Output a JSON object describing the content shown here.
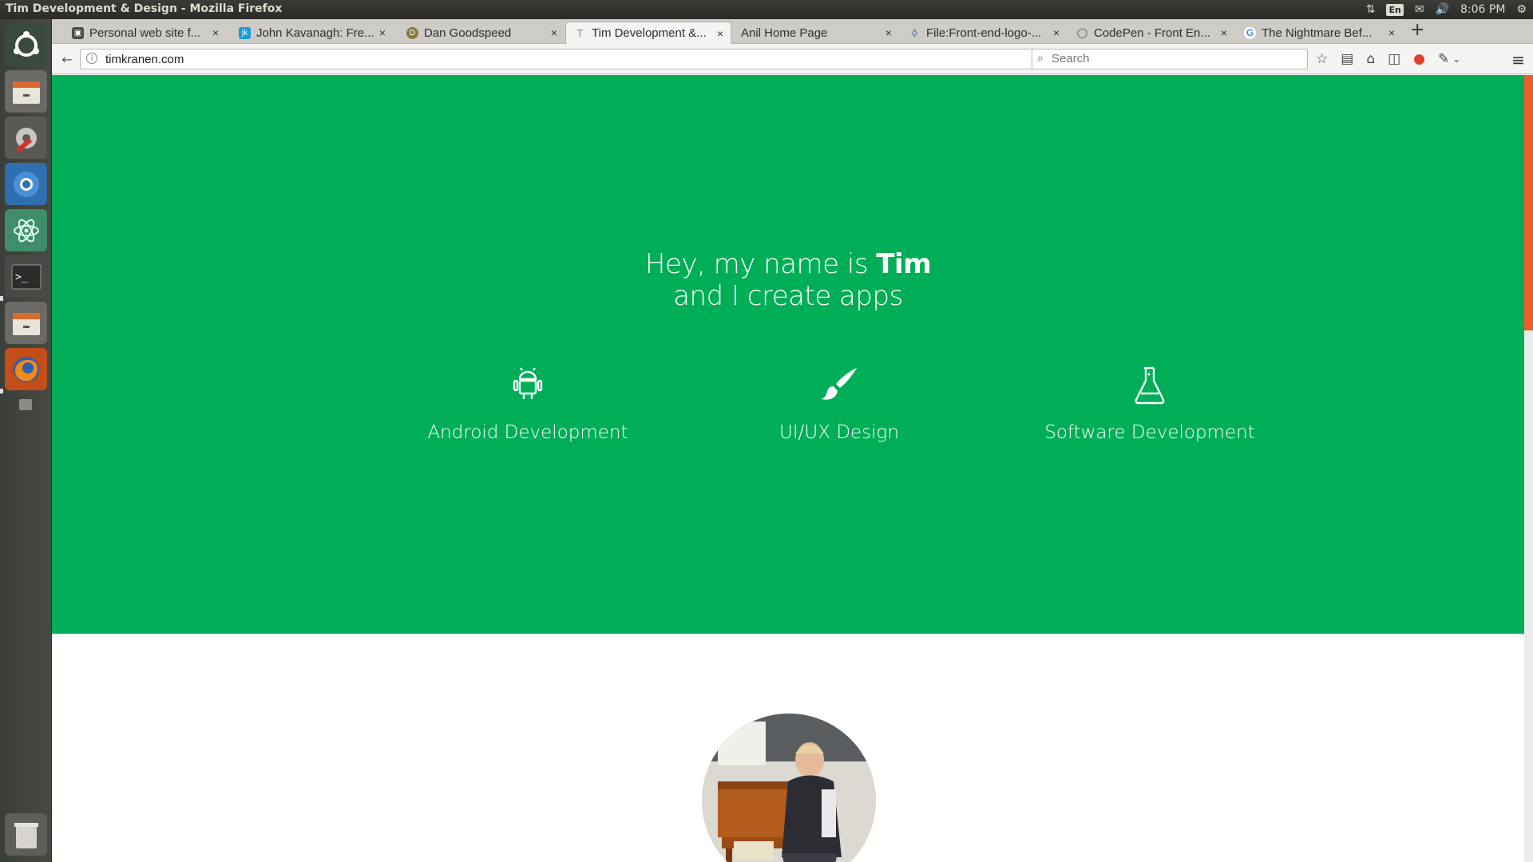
{
  "system": {
    "window_title": "Tim Development & Design - Mozilla Firefox",
    "keyboard_layout": "En",
    "clock": "8:06 PM"
  },
  "browser": {
    "tabs": [
      {
        "label": "Personal web site f...",
        "favicon": "image-favicon-icon",
        "color": "#4a4a4a"
      },
      {
        "label": "John Kavanagh: Fre...",
        "favicon": "jk-favicon-icon",
        "color": "#1a9bd7"
      },
      {
        "label": "Dan Goodspeed",
        "favicon": "dg-favicon-icon",
        "color": "#8a7a3a"
      },
      {
        "label": "Tim Development &...",
        "favicon": "t-favicon-icon",
        "color": "#999999"
      },
      {
        "label": "Anil Home Page",
        "favicon": "blank-favicon-icon",
        "color": "transparent"
      },
      {
        "label": "File:Front-end-logo-...",
        "favicon": "wiki-favicon-icon",
        "color": "#1f4fa0"
      },
      {
        "label": "CodePen - Front En...",
        "favicon": "codepen-favicon-icon",
        "color": "#444444"
      },
      {
        "label": "The Nightmare Bef...",
        "favicon": "google-favicon-icon",
        "color": "#4285f4"
      }
    ],
    "url": "timkranen.com",
    "search_placeholder": "Search"
  },
  "page": {
    "hero": {
      "line1_prefix": "Hey, my name is ",
      "line1_name": "Tim",
      "line2": "and I create apps",
      "background": "#00ae57"
    },
    "services": [
      {
        "label": "Android Development",
        "icon": "android-icon"
      },
      {
        "label": "UI/UX Design",
        "icon": "paintbrush-icon"
      },
      {
        "label": "Software Development",
        "icon": "flask-icon"
      }
    ],
    "scroll_accent": "#f15a29"
  }
}
